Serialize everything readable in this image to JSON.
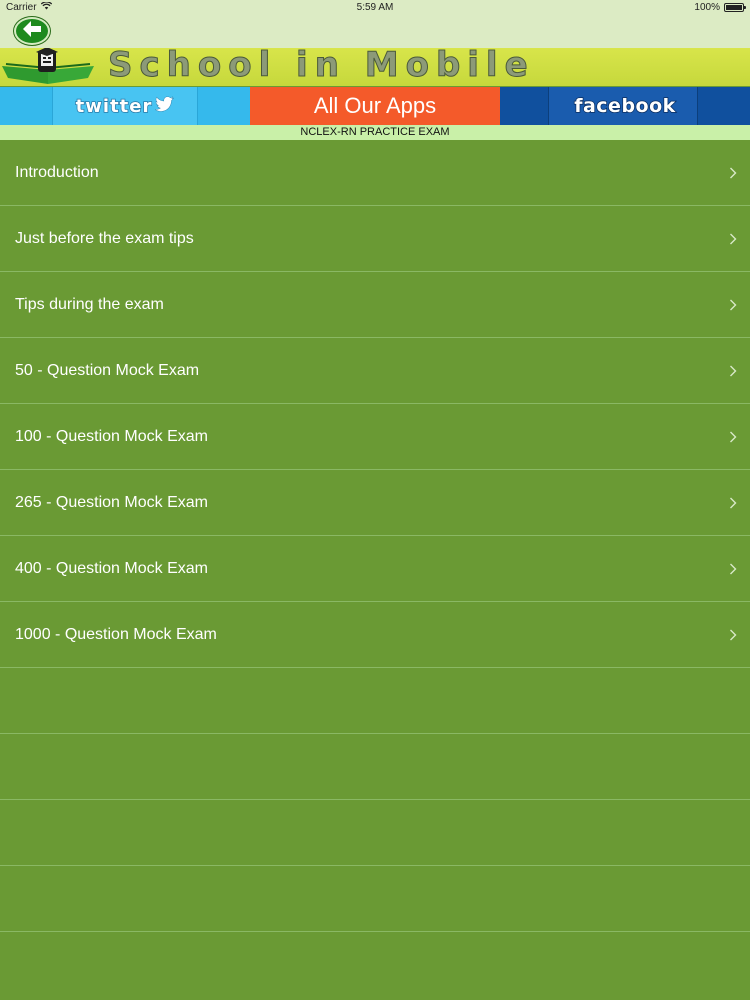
{
  "status_bar": {
    "carrier": "Carrier",
    "time": "5:59 AM",
    "battery": "100%",
    "battery_level": 1.0
  },
  "nav": {
    "back_icon": "arrow-left-icon"
  },
  "banner": {
    "title": "School in Mobile",
    "logo_icon": "graduation-cap-book-icon"
  },
  "social": {
    "twitter_label": "twitter",
    "apps_label": "All Our Apps",
    "facebook_label": "facebook"
  },
  "subheader": {
    "title": "NCLEX-RN PRACTICE EXAM"
  },
  "menu": {
    "items": [
      {
        "label": "Introduction"
      },
      {
        "label": "Just before the exam tips"
      },
      {
        "label": "Tips during the exam"
      },
      {
        "label": "50 - Question Mock Exam"
      },
      {
        "label": "100 - Question Mock Exam"
      },
      {
        "label": "265 - Question Mock Exam"
      },
      {
        "label": "400 - Question Mock Exam"
      },
      {
        "label": "1000 - Question Mock Exam"
      }
    ]
  },
  "colors": {
    "list_background": "#6a9a34",
    "banner_background": "#d8e54a",
    "twitter": "#35b9ec",
    "apps": "#f45a2a",
    "facebook": "#10509e",
    "subheader_background": "#c9f0a8"
  }
}
